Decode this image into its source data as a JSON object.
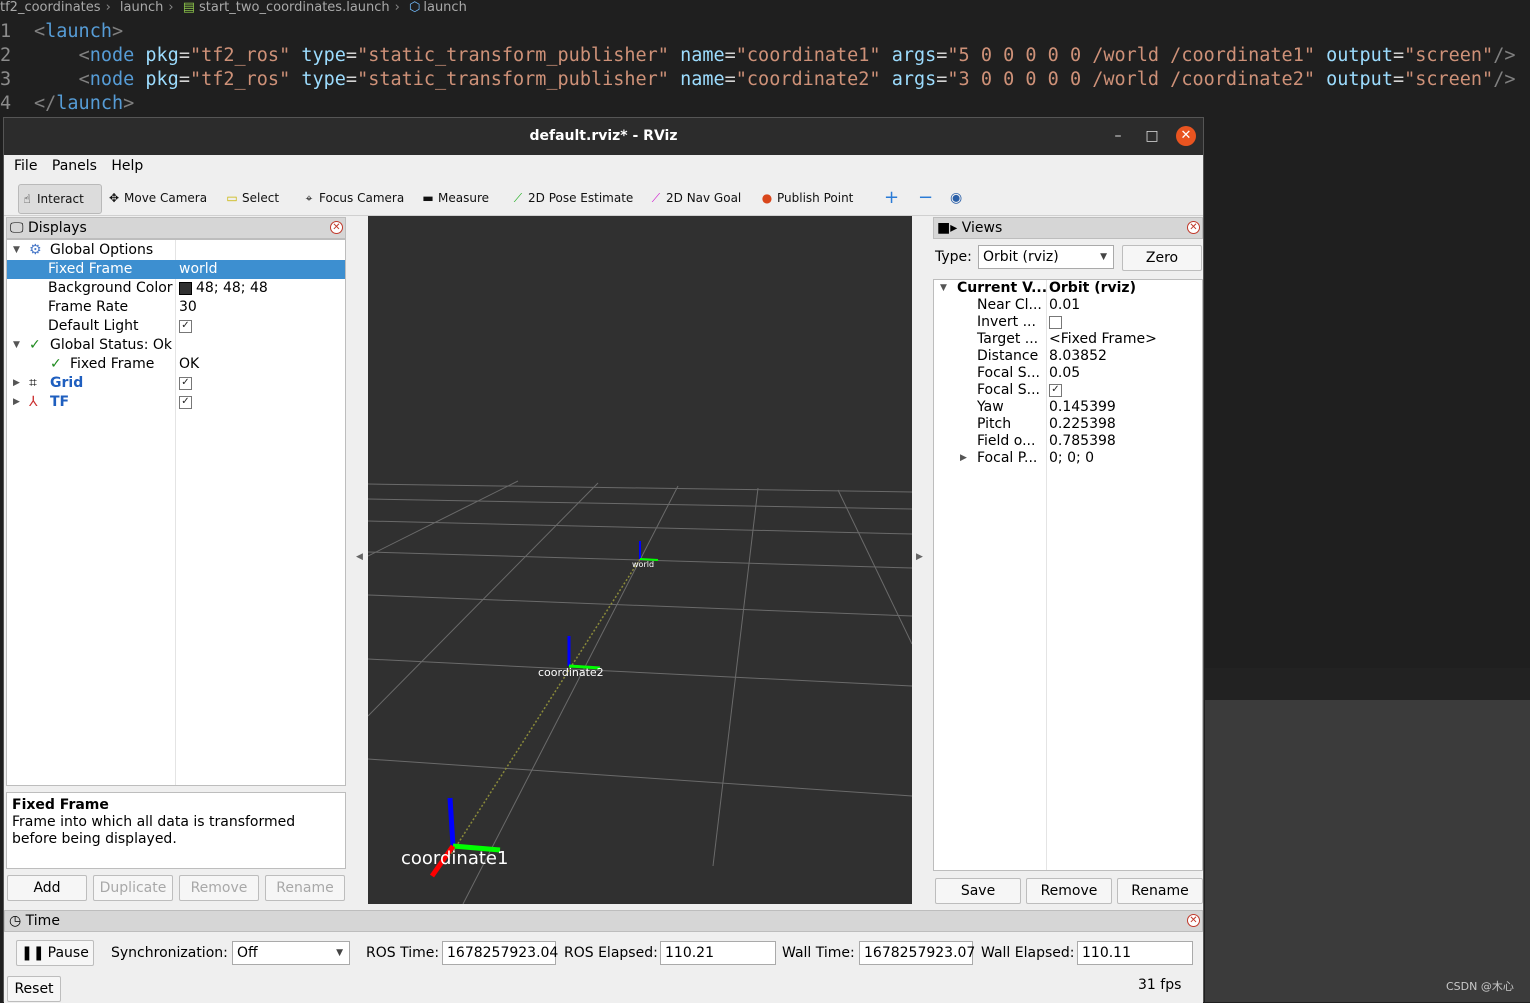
{
  "breadcrumb": [
    "tf2_coordinates",
    "launch",
    "start_two_coordinates.launch",
    "launch"
  ],
  "code": {
    "line_numbers": [
      "1",
      "2",
      "3",
      "4"
    ],
    "open_tag": "launch",
    "close_tag": "launch",
    "nodes": [
      {
        "pkg": "\"tf2_ros\"",
        "type": "\"static_transform_publisher\"",
        "name": "\"coordinate1\"",
        "args": "\"5 0 0 0 0 0 /world /coordinate1\"",
        "output": "\"screen\""
      },
      {
        "pkg": "\"tf2_ros\"",
        "type": "\"static_transform_publisher\"",
        "name": "\"coordinate2\"",
        "args": "\"3 0 0 0 0 0 /world /coordinate2\"",
        "output": "\"screen\""
      }
    ]
  },
  "window": {
    "title": "default.rviz* - RViz"
  },
  "menu": {
    "file": "File",
    "panels": "Panels",
    "help": "Help"
  },
  "toolbar": {
    "interact": "Interact",
    "move_camera": "Move Camera",
    "select": "Select",
    "focus_camera": "Focus Camera",
    "measure": "Measure",
    "pose_estimate": "2D Pose Estimate",
    "nav_goal": "2D Nav Goal",
    "publish_point": "Publish Point"
  },
  "displays": {
    "title": "Displays",
    "global_options": "Global Options",
    "fixed_frame_label": "Fixed Frame",
    "fixed_frame_value": "world",
    "bg_color_label": "Background Color",
    "bg_color_value": "48; 48; 48",
    "bg_color_swatch": "#303030",
    "frame_rate_label": "Frame Rate",
    "frame_rate_value": "30",
    "default_light_label": "Default Light",
    "global_status": "Global Status: Ok",
    "status_fixed_frame": "Fixed Frame",
    "status_fixed_frame_value": "OK",
    "grid": "Grid",
    "tf": "TF",
    "desc_title": "Fixed Frame",
    "desc_text": "Frame into which all data is transformed before being displayed.",
    "add": "Add",
    "duplicate": "Duplicate",
    "remove": "Remove",
    "rename": "Rename"
  },
  "viewport": {
    "frames": {
      "world": "world",
      "coordinate2": "coordinate2",
      "coordinate1": "coordinate1"
    }
  },
  "views": {
    "title": "Views",
    "type_label": "Type:",
    "type_value": "Orbit (rviz)",
    "zero": "Zero",
    "current_view": "Current V...",
    "current_view_value": "Orbit (rviz)",
    "rows": [
      {
        "k": "Near Cl...",
        "v": "0.01"
      },
      {
        "k": "Invert ...",
        "v": ""
      },
      {
        "k": "Target ...",
        "v": "<Fixed Frame>"
      },
      {
        "k": "Distance",
        "v": "8.03852"
      },
      {
        "k": "Focal S...",
        "v": "0.05"
      },
      {
        "k": "Focal S...",
        "v": ""
      },
      {
        "k": "Yaw",
        "v": "0.145399"
      },
      {
        "k": "Pitch",
        "v": "0.225398"
      },
      {
        "k": "Field o...",
        "v": "0.785398"
      },
      {
        "k": "Focal P...",
        "v": "0; 0; 0"
      }
    ],
    "save": "Save",
    "remove": "Remove",
    "rename": "Rename"
  },
  "time": {
    "title": "Time",
    "pause": "Pause",
    "sync_label": "Synchronization:",
    "sync_value": "Off",
    "ros_time_label": "ROS Time:",
    "ros_time": "1678257923.04",
    "ros_elapsed_label": "ROS Elapsed:",
    "ros_elapsed": "110.21",
    "wall_time_label": "Wall Time:",
    "wall_time": "1678257923.07",
    "wall_elapsed_label": "Wall Elapsed:",
    "wall_elapsed": "110.11",
    "reset": "Reset",
    "fps": "31 fps"
  },
  "watermark": "CSDN @木心"
}
